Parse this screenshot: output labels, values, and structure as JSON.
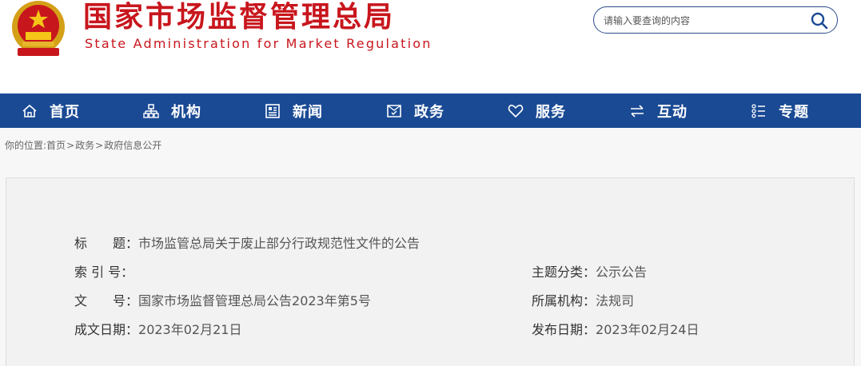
{
  "header": {
    "title_cn": "国家市场监督管理总局",
    "title_en": "State Administration for Market Regulation",
    "emblem": "national-emblem"
  },
  "search": {
    "placeholder": "请输入要查询的内容",
    "icon": "search-icon"
  },
  "nav": {
    "items": [
      {
        "label": "首页",
        "icon": "home-icon"
      },
      {
        "label": "机构",
        "icon": "org-icon"
      },
      {
        "label": "新闻",
        "icon": "news-icon"
      },
      {
        "label": "政务",
        "icon": "gov-icon"
      },
      {
        "label": "服务",
        "icon": "heart-icon"
      },
      {
        "label": "互动",
        "icon": "exchange-icon"
      },
      {
        "label": "专题",
        "icon": "list-icon"
      }
    ]
  },
  "breadcrumb": {
    "prefix": "你的位置:",
    "items": [
      "首页",
      "政务",
      "政府信息公开"
    ],
    "separator": ">"
  },
  "info": {
    "title_label": "标　　题：",
    "title_value": "市场监管总局关于废止部分行政规范性文件的公告",
    "index_label": "索 引 号：",
    "index_value": "",
    "topic_label": "主题分类：",
    "topic_value": "公示公告",
    "doc_no_label": "文　　号：",
    "doc_no_value": "国家市场监督管理总局公告2023年第5号",
    "org_label": "所属机构：",
    "org_value": "法规司",
    "created_label": "成文日期：",
    "created_value": "2023年02月21日",
    "published_label": "发布日期：",
    "published_value": "2023年02月24日"
  },
  "colors": {
    "brand_red": "#c8161d",
    "nav_blue": "#1a4a94"
  }
}
